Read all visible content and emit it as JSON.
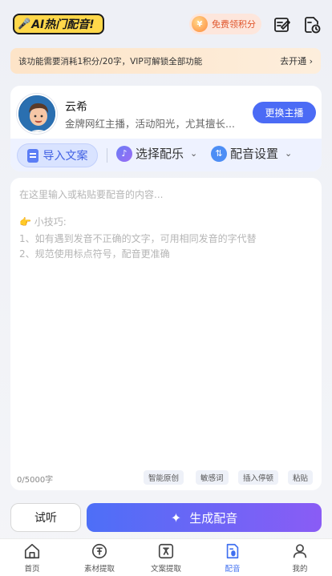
{
  "header": {
    "logo_text": "AI热门配音!",
    "points_label": "免费领积分"
  },
  "vip_banner": {
    "text": "该功能需要消耗1积分/20字，VIP可解锁全部功能",
    "open_label": "去开通 ›"
  },
  "anchor": {
    "name": "云希",
    "description": "金牌网红主播，活动阳光，尤其擅长...",
    "change_label": "更换主播"
  },
  "toolbar": {
    "import_label": "导入文案",
    "music_label": "选择配乐",
    "settings_label": "配音设置"
  },
  "editor": {
    "placeholder": "在这里输入或粘贴要配音的内容...",
    "tips_title": "👉 小技巧:",
    "tips": [
      "1、如有遇到发音不正确的文字，可用相同发音的字代替",
      "2、规范使用标点符号，配音更准确"
    ],
    "char_count": "0/5000字",
    "chips": [
      "智能原创",
      "敏感词",
      "插入停顿",
      "粘贴"
    ]
  },
  "actions": {
    "listen_label": "试听",
    "generate_label": "生成配音"
  },
  "tabs": [
    {
      "label": "首页",
      "icon": "home-icon",
      "active": false
    },
    {
      "label": "素材提取",
      "icon": "material-icon",
      "active": false
    },
    {
      "label": "文案提取",
      "icon": "text-extract-icon",
      "active": false
    },
    {
      "label": "配音",
      "icon": "dubbing-icon",
      "active": true
    },
    {
      "label": "我的",
      "icon": "profile-icon",
      "active": false
    }
  ],
  "colors": {
    "accent": "#4b6bf5",
    "logo_bg": "#ffd84a",
    "points_text": "#e0562d",
    "vip_bg": "#fde4c8"
  }
}
